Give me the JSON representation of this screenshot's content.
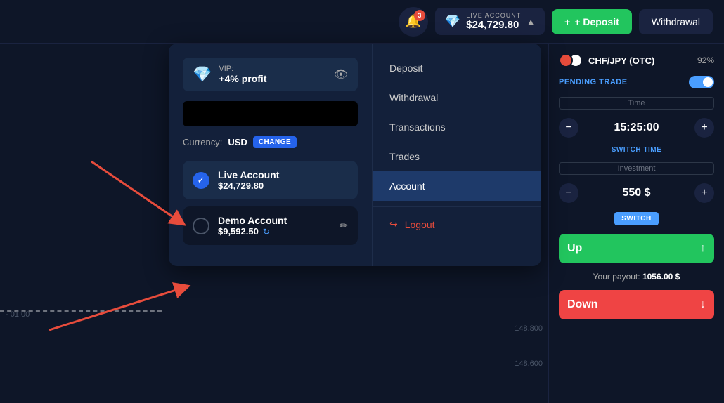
{
  "header": {
    "notif_count": "3",
    "account_label": "LIVE ACCOUNT",
    "account_amount": "$24,729.80",
    "deposit_label": "+ Deposit",
    "withdrawal_label": "Withdrawal"
  },
  "dropdown": {
    "vip_label": "VIP:",
    "vip_profit": "+4% profit",
    "currency_label": "Currency:",
    "currency_value": "USD",
    "change_label": "CHANGE",
    "live_account_name": "Live Account",
    "live_account_balance": "$24,729.80",
    "demo_account_name": "Demo Account",
    "demo_account_balance": "$9,592.50",
    "menu": {
      "deposit": "Deposit",
      "withdrawal": "Withdrawal",
      "transactions": "Transactions",
      "trades": "Trades",
      "account": "Account",
      "logout": "Logout"
    }
  },
  "right_panel": {
    "pair": "CHF/JPY (OTC)",
    "pair_pct": "92%",
    "pending_label": "PENDING TRADE",
    "time_label": "Time",
    "time_value": "15:25:00",
    "switch_time_label": "SWITCH TIME",
    "investment_label": "Investment",
    "investment_value": "550 $",
    "switch_label": "SWITCH",
    "up_label": "Up",
    "down_label": "Down",
    "payout_prefix": "Your payout:",
    "payout_value": "1056.00 $"
  },
  "chart": {
    "label_1": "148.800",
    "label_2": "148.600",
    "time_label": "- 01:00"
  }
}
